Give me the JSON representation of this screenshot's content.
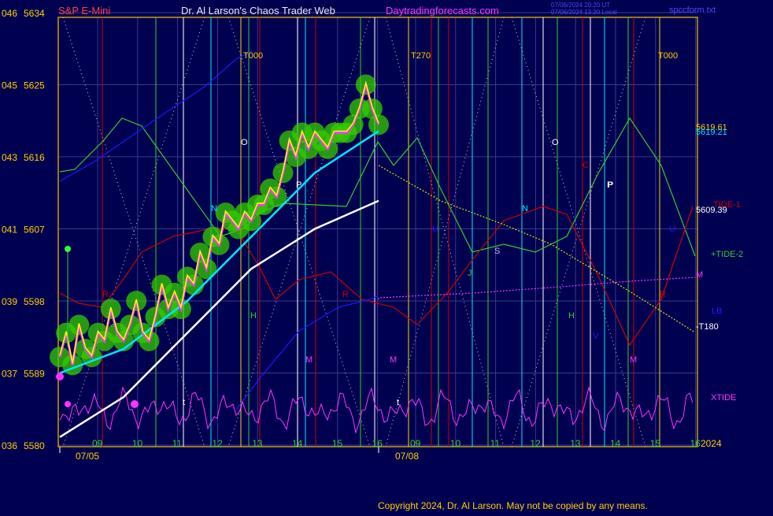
{
  "header": {
    "symbol": "S&P E-Mini",
    "title": "Dr. Al Larson's Chaos Trader Web",
    "site": "Daytradingforecasts.com",
    "stamp1": "07/06/2024 20:20 UT",
    "stamp2": "07/06/2024 13:20 Local",
    "file": "spccform.txt"
  },
  "footer": {
    "copyright": "Copyright 2024, Dr. Al Larson. May not be copied by any means."
  },
  "colors": {
    "background": "#000050",
    "grid": "#3a3a8a",
    "axis": "#c8a000",
    "price": "#ffff00",
    "price_glow": "#33cc00",
    "price_core": "#ff33ff",
    "avg_fast": "#00e5ff",
    "avg_slow": "#ffffff",
    "tide1": "#cc0000",
    "tide2": "#33cc33",
    "xtide": "#ff33ff",
    "forecast": "#dddd00",
    "blue_band": "#1a1aff"
  },
  "chart_data": {
    "type": "line",
    "title": "S&P E-Mini",
    "ylim": [
      5580,
      5634
    ],
    "y_ticks": [
      {
        "left": "046",
        "value": 5634
      },
      {
        "left": "045",
        "value": 5625
      },
      {
        "left": "043",
        "value": 5616
      },
      {
        "left": "041",
        "value": 5607
      },
      {
        "left": "039",
        "value": 5598
      },
      {
        "left": "037",
        "value": 5589
      },
      {
        "left": "036",
        "value": 5580
      }
    ],
    "x_ticks": [
      "09",
      "10",
      "11",
      "12",
      "13",
      "14",
      "15",
      "16",
      "09",
      "10",
      "11",
      "12",
      "13",
      "14",
      "15",
      "16"
    ],
    "date_labels": [
      "07/05",
      "07/08"
    ],
    "year_label": "2024",
    "vertical_markers": [
      "T000",
      "T270",
      "T000"
    ],
    "right_labels": [
      "5619.61",
      "5619.21",
      "TIDE-1",
      "5609.39",
      "+TIDE-2",
      "M",
      "LB",
      "-T180",
      "XTIDE"
    ],
    "chart_letters": [
      "R",
      "H",
      "P",
      "O",
      "R",
      "M",
      "M",
      "P",
      "O",
      "N",
      "S",
      "J",
      "H",
      "P",
      "C",
      "R",
      "M",
      "t",
      "t",
      "N",
      "U",
      "V",
      "U"
    ],
    "series": [
      {
        "name": "S&P E-Mini",
        "points": [
          [
            0,
            5591
          ],
          [
            2,
            5594
          ],
          [
            4,
            5590
          ],
          [
            6,
            5595
          ],
          [
            8,
            5592
          ],
          [
            10,
            5591
          ],
          [
            12,
            5594
          ],
          [
            14,
            5593
          ],
          [
            16,
            5597
          ],
          [
            18,
            5594
          ],
          [
            20,
            5593
          ],
          [
            22,
            5595
          ],
          [
            24,
            5598
          ],
          [
            26,
            5594
          ],
          [
            28,
            5593
          ],
          [
            30,
            5596
          ],
          [
            32,
            5600
          ],
          [
            34,
            5597
          ],
          [
            36,
            5599
          ],
          [
            38,
            5597
          ],
          [
            40,
            5601
          ],
          [
            42,
            5600
          ],
          [
            44,
            5604
          ],
          [
            46,
            5602
          ],
          [
            48,
            5606
          ],
          [
            50,
            5605
          ],
          [
            52,
            5609
          ],
          [
            54,
            5608
          ],
          [
            56,
            5607
          ],
          [
            58,
            5609
          ],
          [
            60,
            5608
          ],
          [
            62,
            5610
          ],
          [
            64,
            5610
          ],
          [
            66,
            5612
          ],
          [
            68,
            5611
          ],
          [
            70,
            5614
          ],
          [
            72,
            5618
          ],
          [
            74,
            5616
          ],
          [
            76,
            5619
          ],
          [
            78,
            5617
          ],
          [
            80,
            5619
          ],
          [
            82,
            5618
          ],
          [
            84,
            5617
          ],
          [
            86,
            5619
          ],
          [
            88,
            5619
          ],
          [
            90,
            5619
          ],
          [
            92,
            5620
          ],
          [
            94,
            5622
          ],
          [
            96,
            5625
          ],
          [
            98,
            5622
          ],
          [
            100,
            5620
          ]
        ]
      },
      {
        "name": "",
        "points": [
          [
            0,
            5589
          ],
          [
            20,
            5592
          ],
          [
            40,
            5598
          ],
          [
            60,
            5606
          ],
          [
            80,
            5614
          ],
          [
            100,
            5619.2
          ]
        ]
      },
      {
        "name": "",
        "points": [
          [
            0,
            5581
          ],
          [
            20,
            5586
          ],
          [
            40,
            5594
          ],
          [
            60,
            5602
          ],
          [
            80,
            5607
          ],
          [
            100,
            5610.5
          ]
        ]
      }
    ]
  }
}
